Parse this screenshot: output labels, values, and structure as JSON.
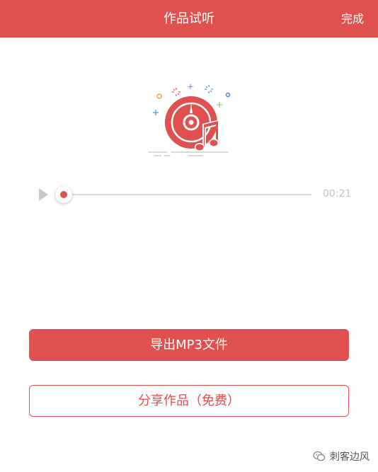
{
  "header": {
    "title": "作品试听",
    "done_label": "完成"
  },
  "player": {
    "elapsed": "00:21",
    "progress": 0.0
  },
  "actions": {
    "export_label": "导出MP3文件",
    "share_label": "分享作品（免费）"
  },
  "watermark": {
    "text": "刺客边风",
    "icon": "wechat-icon"
  },
  "colors": {
    "accent": "#e0504e",
    "track": "#d9d9d9",
    "time_text": "#c4c4c4"
  }
}
